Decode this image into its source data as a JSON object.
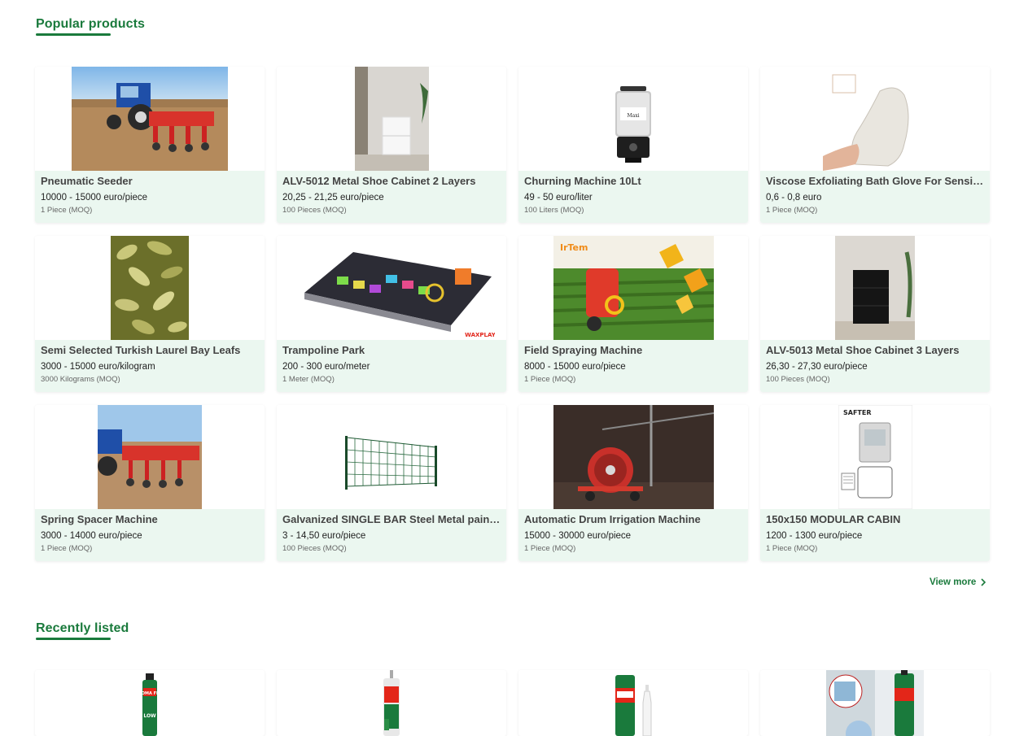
{
  "popular": {
    "title": "Popular products",
    "view_more": "View more",
    "products": [
      {
        "name": "Pneumatic Seeder",
        "price": "10000 - 15000 euro/piece",
        "moq": "1 Piece (MOQ)"
      },
      {
        "name": "ALV-5012 Metal Shoe Cabinet 2 Layers",
        "price": "20,25 - 21,25 euro/piece",
        "moq": "100 Pieces (MOQ)"
      },
      {
        "name": "Churning Machine 10Lt",
        "price": "49 - 50 euro/liter",
        "moq": "100 Liters (MOQ)"
      },
      {
        "name": "Viscose Exfoliating Bath Glove For Sensitive Skin",
        "price": "0,6 - 0,8 euro",
        "moq": "1 Piece (MOQ)"
      },
      {
        "name": "Semi Selected Turkish Laurel Bay Leafs",
        "price": "3000 - 15000 euro/kilogram",
        "moq": "3000 Kilograms (MOQ)"
      },
      {
        "name": "Trampoline Park",
        "price": "200 - 300 euro/meter",
        "moq": "1 Meter (MOQ)"
      },
      {
        "name": "Field Spraying Machine",
        "price": "8000 - 15000 euro/piece",
        "moq": "1 Piece (MOQ)"
      },
      {
        "name": "ALV-5013 Metal Shoe Cabinet 3 Layers",
        "price": "26,30 - 27,30 euro/piece",
        "moq": "100 Pieces (MOQ)"
      },
      {
        "name": "Spring Spacer Machine",
        "price": "3000 - 14000 euro/piece",
        "moq": "1 Piece (MOQ)"
      },
      {
        "name": "Galvanized SINGLE BAR Steel Metal painted Fence",
        "price": "3 - 14,50 euro/piece",
        "moq": "100 Pieces (MOQ)"
      },
      {
        "name": "Automatic Drum Irrigation Machine",
        "price": "15000 - 30000 euro/piece",
        "moq": "1 Piece (MOQ)"
      },
      {
        "name": "150x150 MODULAR CABIN",
        "price": "1200 - 1300 euro/piece",
        "moq": "1 Piece (MOQ)"
      }
    ],
    "image_labels": {
      "irtem": "IrTem",
      "saftek": "SAFTER",
      "soma1": "SOMA FIX",
      "soma2": "LOW",
      "trampoline": "WAXPLAY"
    }
  },
  "recent": {
    "title": "Recently listed"
  },
  "colors": {
    "accent": "#1a7a3c",
    "card_info_bg": "#ebf7f0"
  }
}
